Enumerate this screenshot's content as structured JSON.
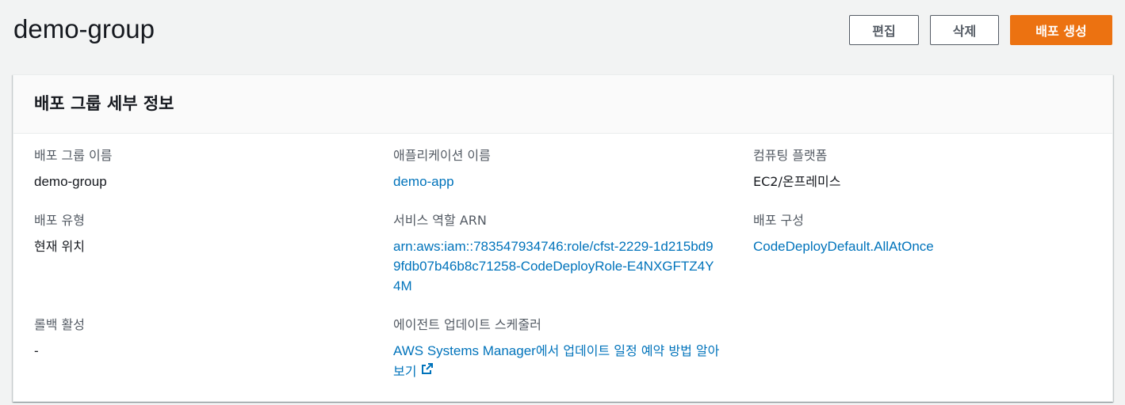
{
  "header": {
    "title": "demo-group",
    "buttons": {
      "edit": "편집",
      "delete": "삭제",
      "create_deployment": "배포 생성"
    }
  },
  "panel": {
    "title": "배포 그룹 세부 정보",
    "fields": {
      "deployment_group_name": {
        "label": "배포 그룹 이름",
        "value": "demo-group"
      },
      "application_name": {
        "label": "애플리케이션 이름",
        "value": "demo-app"
      },
      "compute_platform": {
        "label": "컴퓨팅 플랫폼",
        "value": "EC2/온프레미스"
      },
      "deployment_type": {
        "label": "배포 유형",
        "value": "현재 위치"
      },
      "service_role_arn": {
        "label": "서비스 역할 ARN",
        "value": "arn:aws:iam::783547934746:role/cfst-2229-1d215bd99fdb07b46b8c71258-CodeDeployRole-E4NXGFTZ4Y4M"
      },
      "deployment_config": {
        "label": "배포 구성",
        "value": "CodeDeployDefault.AllAtOnce"
      },
      "rollback_enabled": {
        "label": "롤백 활성",
        "value": "-"
      },
      "agent_update_scheduler": {
        "label": "에이전트 업데이트 스케줄러",
        "link_prefix": "AWS Systems Manager",
        "link_suffix": "에서 업데이트 일정 예약 방법 알아보기",
        "icon": "external-link-icon"
      }
    }
  },
  "colors": {
    "primary_button": "#ec7211",
    "link": "#0073bb",
    "label": "#545b64",
    "background": "#f2f3f3"
  }
}
